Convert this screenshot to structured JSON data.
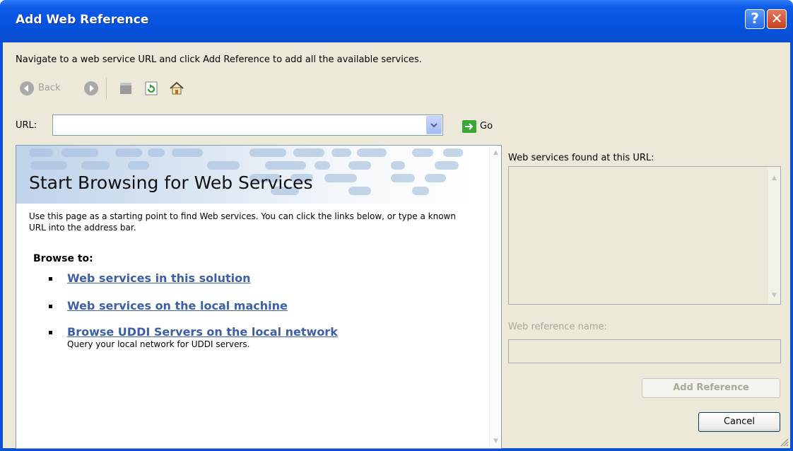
{
  "window": {
    "title": "Add Web Reference",
    "help_button": "?",
    "close_button": "✕"
  },
  "instruction": "Navigate to a web service URL and click Add Reference to add all the available services.",
  "toolbar": {
    "back_label": "Back"
  },
  "url": {
    "label": "URL:",
    "value": "",
    "go_label": "Go"
  },
  "browser": {
    "heading": "Start Browsing for Web Services",
    "intro": "Use this page as a starting point to find Web services. You can click the links below, or type a known URL into the address bar.",
    "browse_to": "Browse to:",
    "links": [
      {
        "label": "Web services in this solution",
        "desc": ""
      },
      {
        "label": "Web services on the local machine",
        "desc": ""
      },
      {
        "label": "Browse UDDI Servers on the local network",
        "desc": "Query your local network for UDDI servers."
      }
    ]
  },
  "right_panel": {
    "found_label": "Web services found at this URL:",
    "ref_name_label": "Web reference name:",
    "ref_name_value": "",
    "add_reference_button": "Add Reference",
    "cancel_button": "Cancel"
  },
  "colors": {
    "titlebar": "#0452de",
    "dialog_bg": "#ece9d8",
    "link": "#3d5fa8"
  }
}
